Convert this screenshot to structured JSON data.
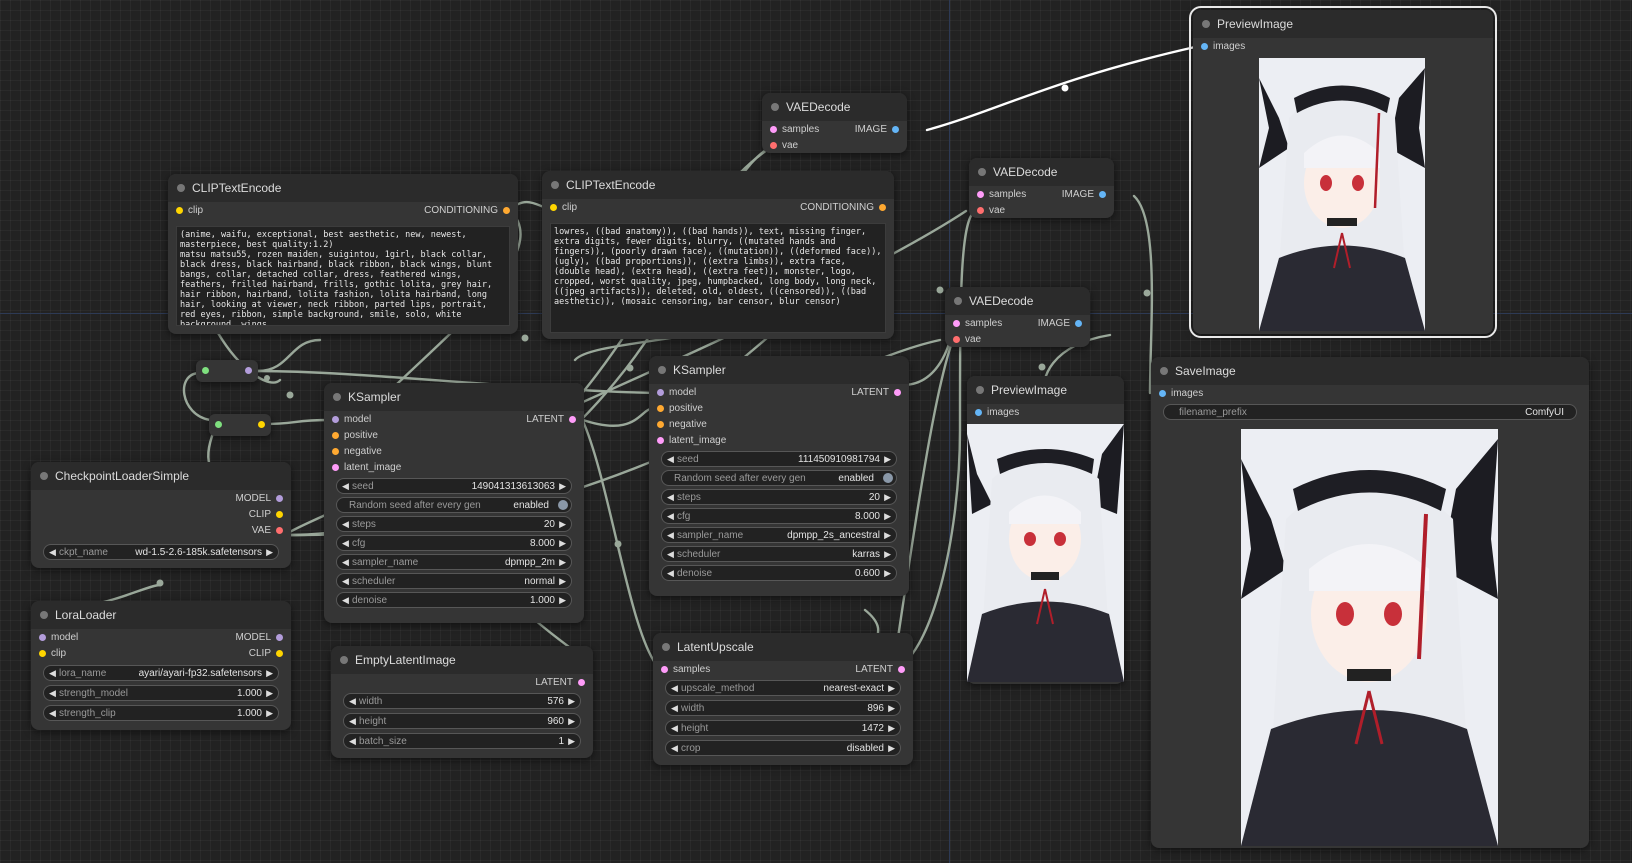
{
  "colors": {
    "background": "#222222",
    "node_body": "#353535",
    "node_header": "#2b2b2b",
    "wire": "#9aa89a",
    "wire_image": "#ffffff",
    "model": "#b39ddb",
    "clip": "#ffd500",
    "vae": "#ff6e6e",
    "conditioning": "#ffa931",
    "latent": "#ff9cf9",
    "image": "#64b5f6"
  },
  "nodes": {
    "clip_pos": {
      "title": "CLIPTextEncode",
      "in_clip": "clip",
      "out_conditioning": "CONDITIONING",
      "text": "(anime, waifu, exceptional, best aesthetic, new, newest, masterpiece, best quality:1.2)\nmatsu matsu55, rozen maiden, suigintou, 1girl, black collar, black dress, black hairband, black ribbon, black wings, blunt bangs, collar, detached collar, dress, feathered wings, feathers, frilled hairband, frills, gothic lolita, grey hair, hair ribbon, hairband, lolita fashion, lolita hairband, long hair, looking at viewer, neck ribbon, parted lips, portrait, red eyes, ribbon, simple background, smile, solo, white background, wings"
    },
    "clip_neg": {
      "title": "CLIPTextEncode",
      "in_clip": "clip",
      "out_conditioning": "CONDITIONING",
      "text": "lowres, ((bad anatomy)), ((bad hands)), text, missing finger, extra digits, fewer digits, blurry, ((mutated hands and fingers)), (poorly drawn face), ((mutation)), ((deformed face)), (ugly), ((bad proportions)), ((extra limbs)), extra face, (double head), (extra head), ((extra feet)), monster, logo, cropped, worst quality, jpeg, humpbacked, long body, long neck, ((jpeg artifacts)), deleted, old, oldest, ((censored)), ((bad aesthetic)), (mosaic censoring, bar censor, blur censor)"
    },
    "vae_decode_1": {
      "title": "VAEDecode",
      "in_samples": "samples",
      "in_vae": "vae",
      "out_image": "IMAGE"
    },
    "vae_decode_2": {
      "title": "VAEDecode",
      "in_samples": "samples",
      "in_vae": "vae",
      "out_image": "IMAGE"
    },
    "vae_decode_3": {
      "title": "VAEDecode",
      "in_samples": "samples",
      "in_vae": "vae",
      "out_image": "IMAGE"
    },
    "preview_top": {
      "title": "PreviewImage",
      "in_images": "images"
    },
    "preview_mid": {
      "title": "PreviewImage",
      "in_images": "images"
    },
    "save_image": {
      "title": "SaveImage",
      "in_images": "images",
      "filename_prefix_label": "filename_prefix",
      "filename_prefix": "ComfyUI"
    },
    "ksampler_1": {
      "title": "KSampler",
      "in_model": "model",
      "in_positive": "positive",
      "in_negative": "negative",
      "in_latent": "latent_image",
      "out_latent": "LATENT",
      "widgets": [
        {
          "label": "seed",
          "value": "149041313613063"
        },
        {
          "label": "Random seed after every gen",
          "value": "enabled"
        },
        {
          "label": "steps",
          "value": "20"
        },
        {
          "label": "cfg",
          "value": "8.000"
        },
        {
          "label": "sampler_name",
          "value": "dpmpp_2m"
        },
        {
          "label": "scheduler",
          "value": "normal"
        },
        {
          "label": "denoise",
          "value": "1.000"
        }
      ]
    },
    "ksampler_2": {
      "title": "KSampler",
      "in_model": "model",
      "in_positive": "positive",
      "in_negative": "negative",
      "in_latent": "latent_image",
      "out_latent": "LATENT",
      "widgets": [
        {
          "label": "seed",
          "value": "111450910981794"
        },
        {
          "label": "Random seed after every gen",
          "value": "enabled"
        },
        {
          "label": "steps",
          "value": "20"
        },
        {
          "label": "cfg",
          "value": "8.000"
        },
        {
          "label": "sampler_name",
          "value": "dpmpp_2s_ancestral"
        },
        {
          "label": "scheduler",
          "value": "karras"
        },
        {
          "label": "denoise",
          "value": "0.600"
        }
      ]
    },
    "checkpoint": {
      "title": "CheckpointLoaderSimple",
      "out_model": "MODEL",
      "out_clip": "CLIP",
      "out_vae": "VAE",
      "widgets": [
        {
          "label": "ckpt_name",
          "value": "wd-1.5-2.6-185k.safetensors"
        }
      ]
    },
    "lora": {
      "title": "LoraLoader",
      "in_model": "model",
      "in_clip": "clip",
      "out_model": "MODEL",
      "out_clip": "CLIP",
      "widgets": [
        {
          "label": "lora_name",
          "value": "ayari/ayari-fp32.safetensors"
        },
        {
          "label": "strength_model",
          "value": "1.000"
        },
        {
          "label": "strength_clip",
          "value": "1.000"
        }
      ]
    },
    "empty_latent": {
      "title": "EmptyLatentImage",
      "out_latent": "LATENT",
      "widgets": [
        {
          "label": "width",
          "value": "576"
        },
        {
          "label": "height",
          "value": "960"
        },
        {
          "label": "batch_size",
          "value": "1"
        }
      ]
    },
    "latent_upscale": {
      "title": "LatentUpscale",
      "in_samples": "samples",
      "out_latent": "LATENT",
      "widgets": [
        {
          "label": "upscale_method",
          "value": "nearest-exact"
        },
        {
          "label": "width",
          "value": "896"
        },
        {
          "label": "height",
          "value": "1472"
        },
        {
          "label": "crop",
          "value": "disabled"
        }
      ]
    }
  }
}
